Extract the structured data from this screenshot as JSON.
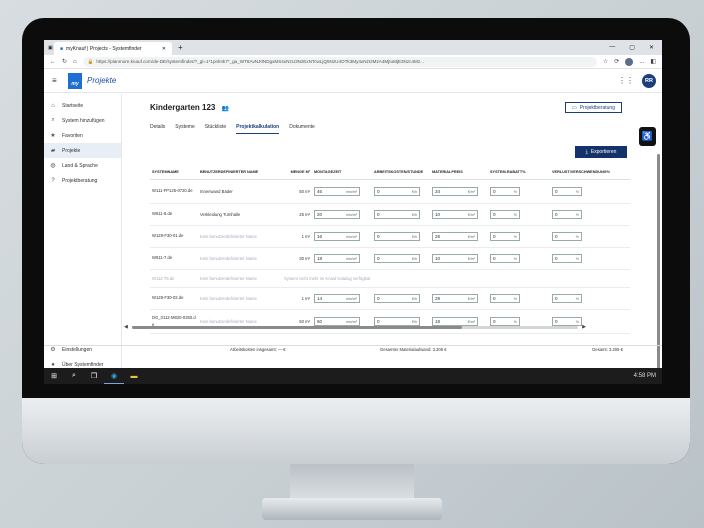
{
  "browser": {
    "tab_title": "myKnauf | Projects - Systemfinder",
    "url": "https://planmore.knauf.com/de-DE/systemfinder/?_gl=1*1pnlmk7*_ga_WT8AvNJ0NDgxMS4xNzU3NzExNTcwLjQ5NzU4OTk3My4xNzI2MzA4MjIuMjE3Nzc4Mz...",
    "menu": "..."
  },
  "app": {
    "logo": "my",
    "name": "Projekte",
    "user_initials": "RR"
  },
  "sidebar": {
    "items": [
      {
        "label": "Startseite",
        "icon": "home-icon"
      },
      {
        "label": "System hinzufügen",
        "icon": "search-icon"
      },
      {
        "label": "Favoriten",
        "icon": "star-icon"
      },
      {
        "label": "Projekte",
        "icon": "folder-icon"
      },
      {
        "label": "Land & Sprache",
        "icon": "globe-icon"
      },
      {
        "label": "Projektberatung",
        "icon": "help-icon"
      }
    ],
    "bottom": [
      {
        "label": "Einstellungen",
        "icon": "gear-icon"
      },
      {
        "label": "Über Systemfinder",
        "icon": "info-icon"
      }
    ]
  },
  "project": {
    "title": "Kindergarten 123",
    "beratung_label": "Projektberatung",
    "export_label": "Exportieren",
    "tabs": [
      "Details",
      "Systeme",
      "Stückliste",
      "Projektkalkulation",
      "Dokumente"
    ],
    "active_tab": "Projektkalkulation"
  },
  "table": {
    "headers": [
      "Systemname",
      "Benutzerdefinierter Name",
      "Menge m²",
      "Montagezeit",
      "Arbeitskosten/Stunde",
      "Materialpreis",
      "System-Rabatt%",
      "Verlust/Verschwendung%"
    ],
    "rows": [
      {
        "name": "W111-FP125-0720.de",
        "custom": "Innenwand Bäder",
        "qty": "50 m²",
        "time": "46",
        "time_u": "min/m²",
        "labor": "0",
        "labor_u": "€/h",
        "mat": "34",
        "mat_u": "€/m²",
        "disc": "0",
        "loss": "0"
      },
      {
        "name": "W611-8.de",
        "custom": "Verkleidung Turnhalle",
        "qty": "25 m²",
        "time": "20",
        "time_u": "min/m²",
        "labor": "0",
        "labor_u": "€/h",
        "mat": "10",
        "mat_u": "€/m²",
        "disc": "0",
        "loss": "0"
      },
      {
        "name": "W128-F30-01.de",
        "custom": "Kein benutzerdefinierter Name",
        "qty": "1 m²",
        "time": "16",
        "time_u": "min/m²",
        "labor": "0",
        "labor_u": "€/h",
        "mat": "26",
        "mat_u": "€/m²",
        "disc": "0",
        "loss": "0"
      },
      {
        "name": "W611-7.de",
        "custom": "Kein benutzerdefinierter Name",
        "qty": "30 m²",
        "time": "18",
        "time_u": "min/m²",
        "labor": "0",
        "labor_u": "€/h",
        "mat": "10",
        "mat_u": "€/m²",
        "disc": "0",
        "loss": "0"
      },
      {
        "name": "W112-75.de",
        "custom": "Kein benutzerdefinierter Name",
        "note": "System nicht mehr im Knauf Katalog verfügbar"
      },
      {
        "name": "W128-F30-02.de",
        "custom": "Kein benutzerdefinierter Name",
        "qty": "1 m²",
        "time": "14",
        "time_u": "min/m²",
        "labor": "0",
        "labor_u": "€/h",
        "mat": "29",
        "mat_u": "€/m²",
        "disc": "0",
        "loss": "0"
      },
      {
        "name": "DG_0112-M820-0250.de",
        "custom": "Kein benutzerdefinierter Name",
        "qty": "50 m²",
        "time": "60",
        "time_u": "min/m²",
        "labor": "0",
        "labor_u": "€/h",
        "mat": "18",
        "mat_u": "€/m²",
        "disc": "0",
        "loss": "0"
      }
    ],
    "pct": "%"
  },
  "footer": {
    "labor": "Arbeitskosten insgesamt: — €",
    "material": "Gesamter Materialaufwand: 3.205 €",
    "total": "Gesamt: 3.205 €"
  },
  "taskbar": {
    "clock": "4:58 PM"
  }
}
